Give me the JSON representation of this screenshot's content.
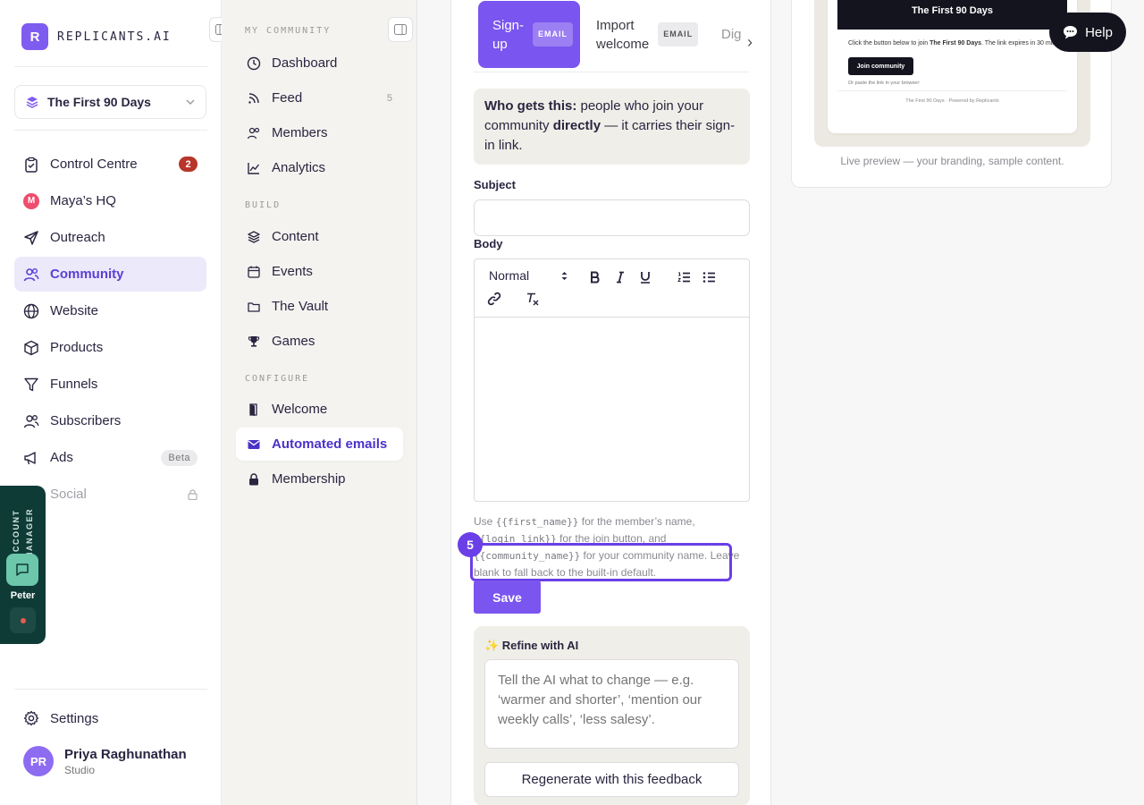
{
  "brand": {
    "mark": "R",
    "name": "REPLICANTS.AI"
  },
  "workspace": {
    "name": "The First 90 Days"
  },
  "nav": {
    "items": [
      {
        "label": "Control Centre",
        "badge": "2"
      },
      {
        "label": "Maya’s HQ",
        "icon_letter": "M"
      },
      {
        "label": "Outreach"
      },
      {
        "label": "Community"
      },
      {
        "label": "Website"
      },
      {
        "label": "Products"
      },
      {
        "label": "Funnels"
      },
      {
        "label": "Subscribers"
      },
      {
        "label": "Ads",
        "badge": "Beta"
      },
      {
        "label": "Social"
      }
    ],
    "settings": "Settings"
  },
  "user": {
    "initials": "PR",
    "name": "Priya Raghunathan",
    "plan": "Studio"
  },
  "account_manager": {
    "title": "ACCOUNT MANAGER",
    "name": "Peter"
  },
  "subnav": {
    "section_community": "MY COMMUNITY",
    "section_build": "BUILD",
    "section_configure": "CONFIGURE",
    "items": [
      {
        "label": "Dashboard"
      },
      {
        "label": "Feed",
        "count": "5"
      },
      {
        "label": "Members"
      },
      {
        "label": "Analytics"
      },
      {
        "label": "Content"
      },
      {
        "label": "Events"
      },
      {
        "label": "The Vault"
      },
      {
        "label": "Games"
      },
      {
        "label": "Welcome"
      },
      {
        "label": "Automated emails"
      },
      {
        "label": "Membership"
      }
    ]
  },
  "editor": {
    "tabs": [
      {
        "label": "Sign-up",
        "tag": "EMAIL"
      },
      {
        "label": "Import welcome",
        "tag": "EMAIL"
      },
      {
        "label": "Dig"
      }
    ],
    "info": {
      "lead": "Who gets this:",
      "text1": " people who join your community ",
      "strong": "directly",
      "text2": " — it carries their sign-in link."
    },
    "subject_label": "Subject",
    "subject_value": "",
    "body_label": "Body",
    "format_select": "Normal",
    "hint": {
      "t1": "Use ",
      "c1": "{{first_name}}",
      "t2": " for the member’s name, ",
      "c2": "{{login_link}}",
      "t3": " for the join button, and ",
      "c3": "{{community_name}}",
      "t4": " for your community name. Leave blank to fall back to the built-in default."
    },
    "step_number": "5",
    "save_label": "Save",
    "refine": {
      "title": "✨ Refine with AI",
      "placeholder": "Tell the AI what to change — e.g. ‘warmer and shorter’, ‘mention our weekly calls’, ‘less salesy’.",
      "button": "Regenerate with this feedback"
    }
  },
  "preview": {
    "header": "The First 90 Days",
    "body_pre": "Click the button below to join ",
    "body_strong": "The First 90 Days",
    "body_post": ". The link expires in 30 minutes.",
    "join_button": "Join community",
    "paste": "Or paste the link in your browser:",
    "footer": "The First 90 Days  ·  Powered by Replicants",
    "caption": "Live preview — your branding, sample content."
  },
  "help": {
    "label": "Help"
  },
  "colors": {
    "accent": "#7a55ef",
    "highlight": "#6a3fe8",
    "active_nav_bg": "#ece9fb",
    "badge_red": "#b8352b"
  }
}
